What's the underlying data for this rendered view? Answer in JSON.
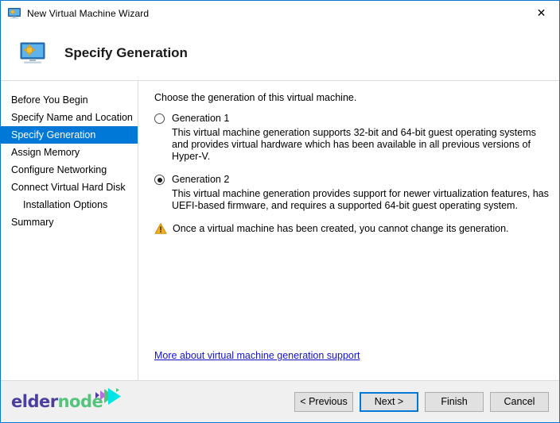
{
  "window": {
    "title": "New Virtual Machine Wizard",
    "icon": "virtual-machine-icon",
    "close_label": "✕",
    "accent_color": "#0078d7"
  },
  "header": {
    "icon": "virtual-machine-icon",
    "title": "Specify Generation"
  },
  "sidebar": {
    "items": [
      {
        "label": "Before You Begin",
        "selected": false,
        "indent": false
      },
      {
        "label": "Specify Name and Location",
        "selected": false,
        "indent": false
      },
      {
        "label": "Specify Generation",
        "selected": true,
        "indent": false
      },
      {
        "label": "Assign Memory",
        "selected": false,
        "indent": false
      },
      {
        "label": "Configure Networking",
        "selected": false,
        "indent": false
      },
      {
        "label": "Connect Virtual Hard Disk",
        "selected": false,
        "indent": false
      },
      {
        "label": "Installation Options",
        "selected": false,
        "indent": true
      },
      {
        "label": "Summary",
        "selected": false,
        "indent": false
      }
    ],
    "selected_background": "#0078d7",
    "selected_foreground": "#ffffff"
  },
  "content": {
    "intro": "Choose the generation of this virtual machine.",
    "options": [
      {
        "label": "Generation 1",
        "checked": false,
        "description": "This virtual machine generation supports 32-bit and 64-bit guest operating systems and provides virtual hardware which has been available in all previous versions of Hyper-V."
      },
      {
        "label": "Generation 2",
        "checked": true,
        "description": "This virtual machine generation provides support for newer virtualization features, has UEFI-based firmware, and requires a supported 64-bit guest operating system."
      }
    ],
    "warning": {
      "icon": "warning-triangle-icon",
      "text": "Once a virtual machine has been created, you cannot change its generation."
    },
    "link": {
      "label": "More about virtual machine generation support",
      "color": "#1414c8"
    }
  },
  "footer": {
    "logo": {
      "text_primary": "elder",
      "text_secondary": "node",
      "color_primary": "#4b3f9e",
      "color_secondary": "#52c47c",
      "mark_colors": [
        "#00e5e5",
        "#52c47c",
        "#b36fd9",
        "#4b3f9e"
      ]
    },
    "buttons": [
      {
        "label": "< Previous",
        "default": false
      },
      {
        "label": "Next >",
        "default": true
      },
      {
        "label": "Finish",
        "default": false
      },
      {
        "label": "Cancel",
        "default": false
      }
    ]
  }
}
